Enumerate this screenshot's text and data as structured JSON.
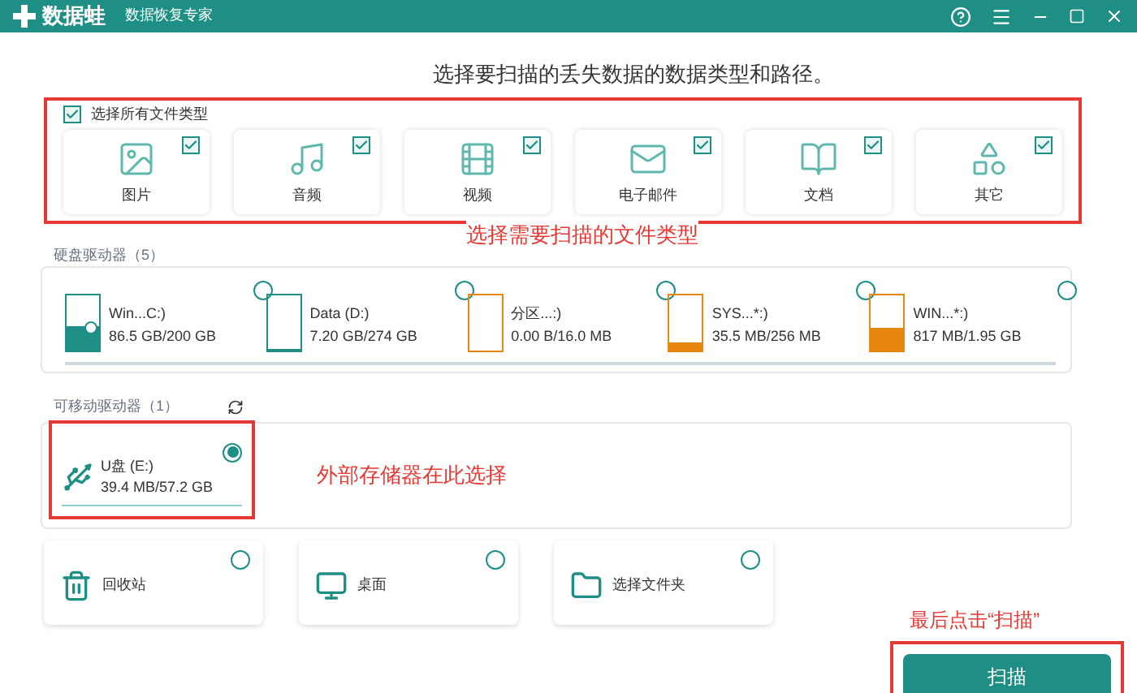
{
  "window": {
    "title": "数据蛙",
    "subtitle": "数据恢复专家"
  },
  "heading": "选择要扫描的丢失数据的数据类型和路径。",
  "file_types": {
    "select_all": {
      "label": "选择所有文件类型",
      "checked": true
    },
    "items": [
      {
        "kind": "image",
        "label": "图片",
        "checked": true
      },
      {
        "kind": "audio",
        "label": "音频",
        "checked": true
      },
      {
        "kind": "video",
        "label": "视频",
        "checked": true
      },
      {
        "kind": "email",
        "label": "电子邮件",
        "checked": true
      },
      {
        "kind": "document",
        "label": "文档",
        "checked": true
      },
      {
        "kind": "other",
        "label": "其它",
        "checked": true
      }
    ]
  },
  "annotation_types": "选择需要扫描的文件类型",
  "hard_drives": {
    "title": "硬盘驱动器（5）",
    "items": [
      {
        "name": "Win...C:)",
        "usage": "86.5 GB/200 GB",
        "level": 0.43,
        "color": "#1f8f86",
        "system": true,
        "selected": false
      },
      {
        "name": "Data (D:)",
        "usage": "7.20 GB/274 GB",
        "level": 0.03,
        "color": "#1f8f86",
        "system": false,
        "selected": false
      },
      {
        "name": "分区...:)",
        "usage": "0.00  B/16.0 MB",
        "level": 0,
        "color": "#e8870f",
        "system": false,
        "selected": false
      },
      {
        "name": "SYS...*:)",
        "usage": "35.5 MB/256 MB",
        "level": 0.14,
        "color": "#e8870f",
        "system": false,
        "selected": false
      },
      {
        "name": "WIN...*:)",
        "usage": "817 MB/1.95 GB",
        "level": 0.41,
        "color": "#e8870f",
        "system": false,
        "selected": false
      }
    ]
  },
  "removable": {
    "title": "可移动驱动器（1）",
    "items": [
      {
        "name": "U盘 (E:)",
        "usage": "39.4 MB/57.2 GB",
        "selected": true
      }
    ]
  },
  "annotation_removable": "外部存储器在此选择",
  "locations": [
    {
      "kind": "recycle",
      "label": "回收站",
      "selected": false
    },
    {
      "kind": "desktop",
      "label": "桌面",
      "selected": false
    },
    {
      "kind": "folder",
      "label": "选择文件夹",
      "selected": false
    }
  ],
  "annotation_scan": "最后点击“扫描”",
  "scan_button": "扫描"
}
